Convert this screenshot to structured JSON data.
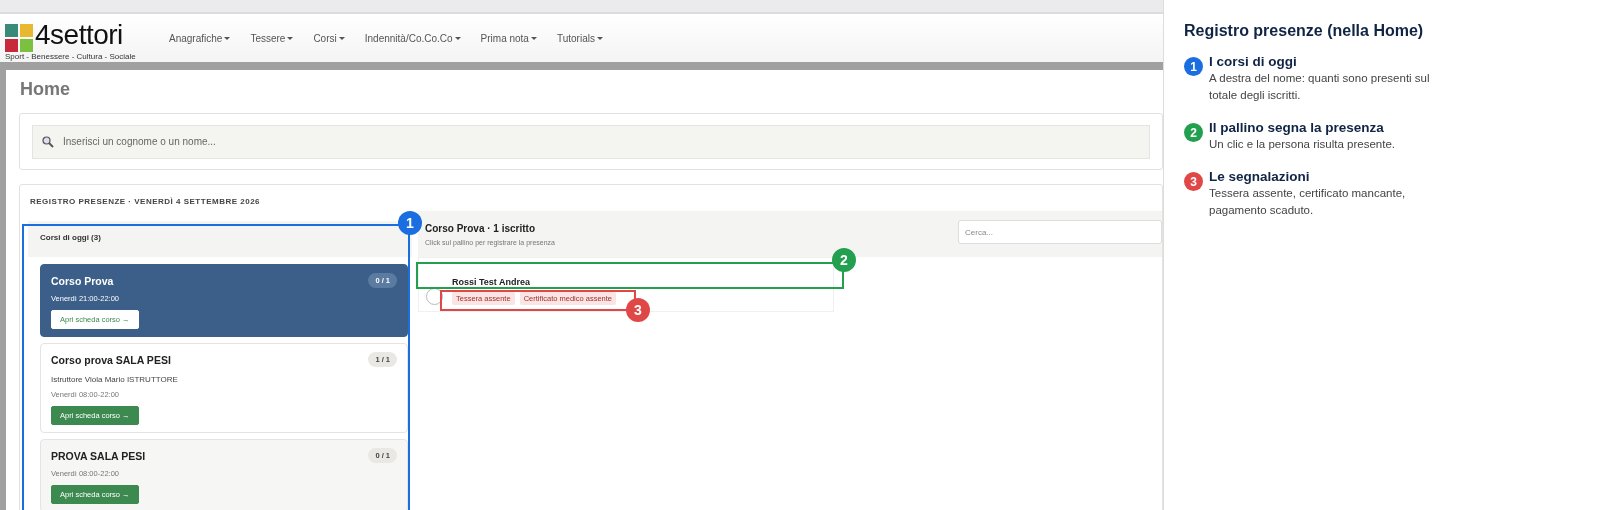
{
  "logo": {
    "name": "4settori",
    "tagline": "Sport - Benessere - Cultura - Sociale"
  },
  "nav": [
    {
      "label": "Anagrafiche"
    },
    {
      "label": "Tessere"
    },
    {
      "label": "Corsi"
    },
    {
      "label": "Indennità/Co.Co.Co"
    },
    {
      "label": "Prima nota"
    },
    {
      "label": "Tutorials"
    }
  ],
  "page_title": "Home",
  "search": {
    "placeholder": "Inserisci un cognome o un nome..."
  },
  "register": {
    "title": "REGISTRO PRESENZE · VENERDÌ 4 SETTEMBRE 2026",
    "courses_header": "Corsi di oggi (3)",
    "courses": [
      {
        "name": "Corso Prova",
        "schedule": "Venerdì 21:00-22:00",
        "count": "0 / 1",
        "button": "Apri scheda corso →",
        "selected": true
      },
      {
        "name": "Corso prova SALA PESI",
        "instructor": "Istruttore Viola Mario ISTRUTTORE",
        "schedule": "Venerdì 08:00-22:00",
        "count": "1 / 1",
        "button": "Apri scheda corso →",
        "selected": false
      },
      {
        "name": "PROVA SALA PESI",
        "schedule": "Venerdì 08:00-22:00",
        "count": "0 / 1",
        "button": "Apri scheda corso →",
        "selected": false
      }
    ],
    "detail": {
      "title": "Corso Prova · 1 iscritto",
      "hint": "Click sul pallino per registrare la presenza",
      "search_placeholder": "Cerca...",
      "students": [
        {
          "name": "Rossi Test Andrea",
          "present": false,
          "tags": [
            "Tessera assente",
            "Certificato medico assente"
          ]
        }
      ]
    }
  },
  "annotations": [
    {
      "number": "1",
      "color": "#1a6ee0"
    },
    {
      "number": "2",
      "color": "#22a050"
    },
    {
      "number": "3",
      "color": "#e04848"
    }
  ],
  "guide": {
    "title": "Registro presenze (nella Home)",
    "steps": [
      {
        "number": "1",
        "color": "#1a6ee0",
        "title": "I corsi di oggi",
        "text": "A destra del nome: quanti sono presenti sul totale degli iscritti."
      },
      {
        "number": "2",
        "color": "#22a050",
        "title": "Il pallino segna la presenza",
        "text": "Un clic e la persona risulta presente."
      },
      {
        "number": "3",
        "color": "#e04848",
        "title": "Le segnalazioni",
        "text": "Tessera assente, certificato mancante, pagamento scaduto."
      }
    ]
  }
}
